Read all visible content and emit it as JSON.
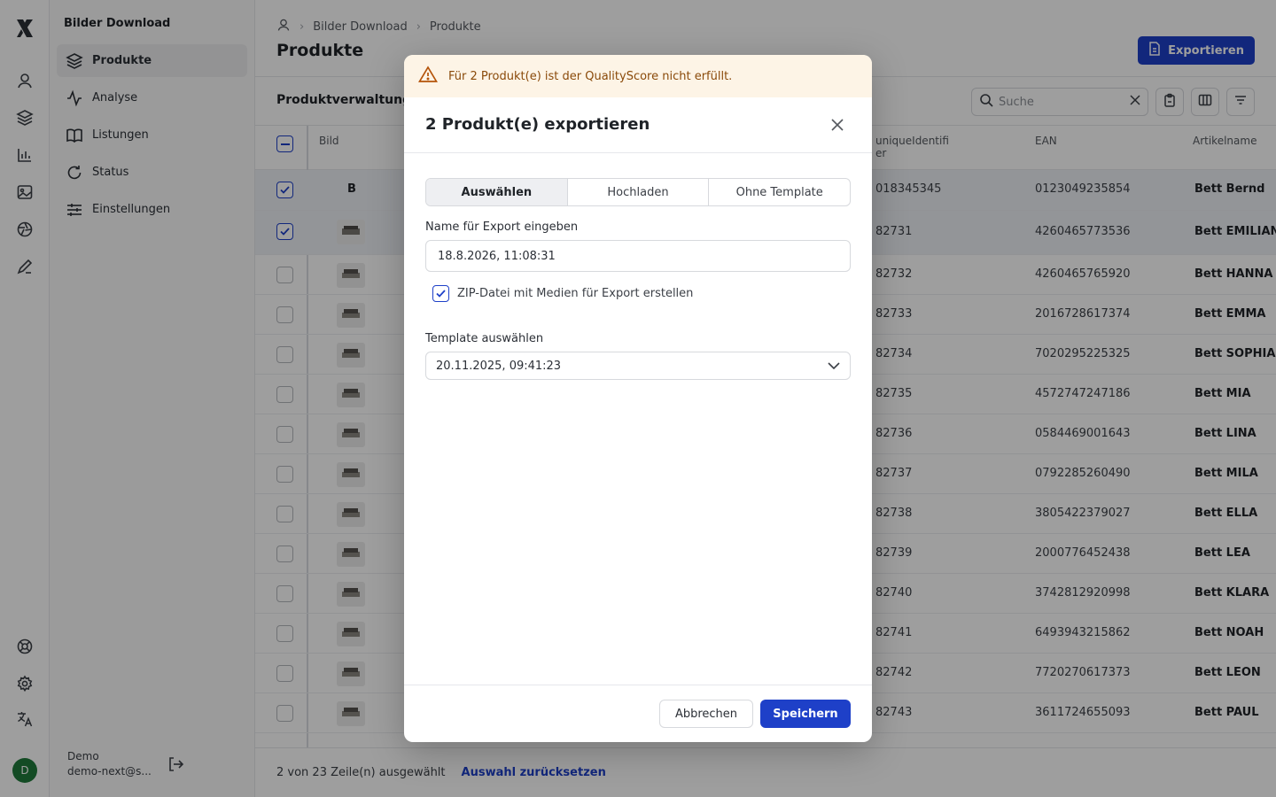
{
  "app": {
    "name": "Bilder Download"
  },
  "sidebar": {
    "items": [
      {
        "label": "Produkte",
        "icon": "layers-icon",
        "active": true
      },
      {
        "label": "Analyse",
        "icon": "activity-icon"
      },
      {
        "label": "Listungen",
        "icon": "book-icon"
      },
      {
        "label": "Status",
        "icon": "refresh-icon"
      },
      {
        "label": "Einstellungen",
        "icon": "sliders-icon"
      }
    ],
    "user": {
      "name": "Demo",
      "email": "demo-next@s...",
      "avatar_initial": "D",
      "avatar_color": "#1f7a3a"
    }
  },
  "header": {
    "breadcrumb": [
      "Bilder Download",
      "Produkte"
    ],
    "title": "Produkte",
    "export_label": "Exportieren"
  },
  "toolbar": {
    "section_title": "Produktverwaltung",
    "search_placeholder": "Suche"
  },
  "table": {
    "columns": {
      "bild": "Bild",
      "uid_a": "uniqueIdentifi",
      "uid_b": "er",
      "ean": "EAN",
      "name": "Artikelname"
    },
    "rows": [
      {
        "img": "B",
        "uid": "018345345",
        "ean": "0123049235854",
        "name": "Bett Bernd",
        "selected": true,
        "text_img": true
      },
      {
        "uid": "82731",
        "ean": "4260465773536",
        "name": "Bett EMILIAN",
        "selected": true
      },
      {
        "uid": "82732",
        "ean": "4260465765920",
        "name": "Bett HANNA"
      },
      {
        "uid": "82733",
        "ean": "2016728617374",
        "name": "Bett EMMA"
      },
      {
        "uid": "82734",
        "ean": "7020295225325",
        "name": "Bett SOPHIA"
      },
      {
        "uid": "82735",
        "ean": "4572747247186",
        "name": "Bett MIA"
      },
      {
        "uid": "82736",
        "ean": "0584469001643",
        "name": "Bett LINA"
      },
      {
        "uid": "82737",
        "ean": "0792285260490",
        "name": "Bett MILA"
      },
      {
        "uid": "82738",
        "ean": "3805422379027",
        "name": "Bett ELLA"
      },
      {
        "uid": "82739",
        "ean": "2000776452438",
        "name": "Bett LEA"
      },
      {
        "uid": "82740",
        "ean": "3742812920998",
        "name": "Bett KLARA"
      },
      {
        "uid": "82741",
        "ean": "6493943215862",
        "name": "Bett NOAH"
      },
      {
        "uid": "82742",
        "ean": "7720270617373",
        "name": "Bett LEON"
      },
      {
        "uid": "82743",
        "ean": "3611724655093",
        "name": "Bett PAUL"
      }
    ]
  },
  "footer": {
    "selection_text": "2 von 23 Zeile(n) ausgewählt",
    "reset_label": "Auswahl zurücksetzen"
  },
  "modal": {
    "warning": "Für 2 Produkt(e) ist der QualityScore nicht erfüllt.",
    "title": "2 Produkt(e) exportieren",
    "tabs": [
      {
        "label": "Auswählen",
        "active": true
      },
      {
        "label": "Hochladen"
      },
      {
        "label": "Ohne Template"
      }
    ],
    "name_label": "Name für Export eingeben",
    "name_value": "18.8.2026, 11:08:31",
    "zip_label": "ZIP-Datei mit Medien für Export erstellen",
    "zip_checked": true,
    "template_label": "Template auswählen",
    "template_value": "20.11.2025, 09:41:23",
    "cancel_label": "Abbrechen",
    "save_label": "Speichern"
  },
  "colors": {
    "accent": "#1e40c8",
    "warning_bg": "#fdf4e6",
    "warning_text": "#8a4a0a"
  }
}
